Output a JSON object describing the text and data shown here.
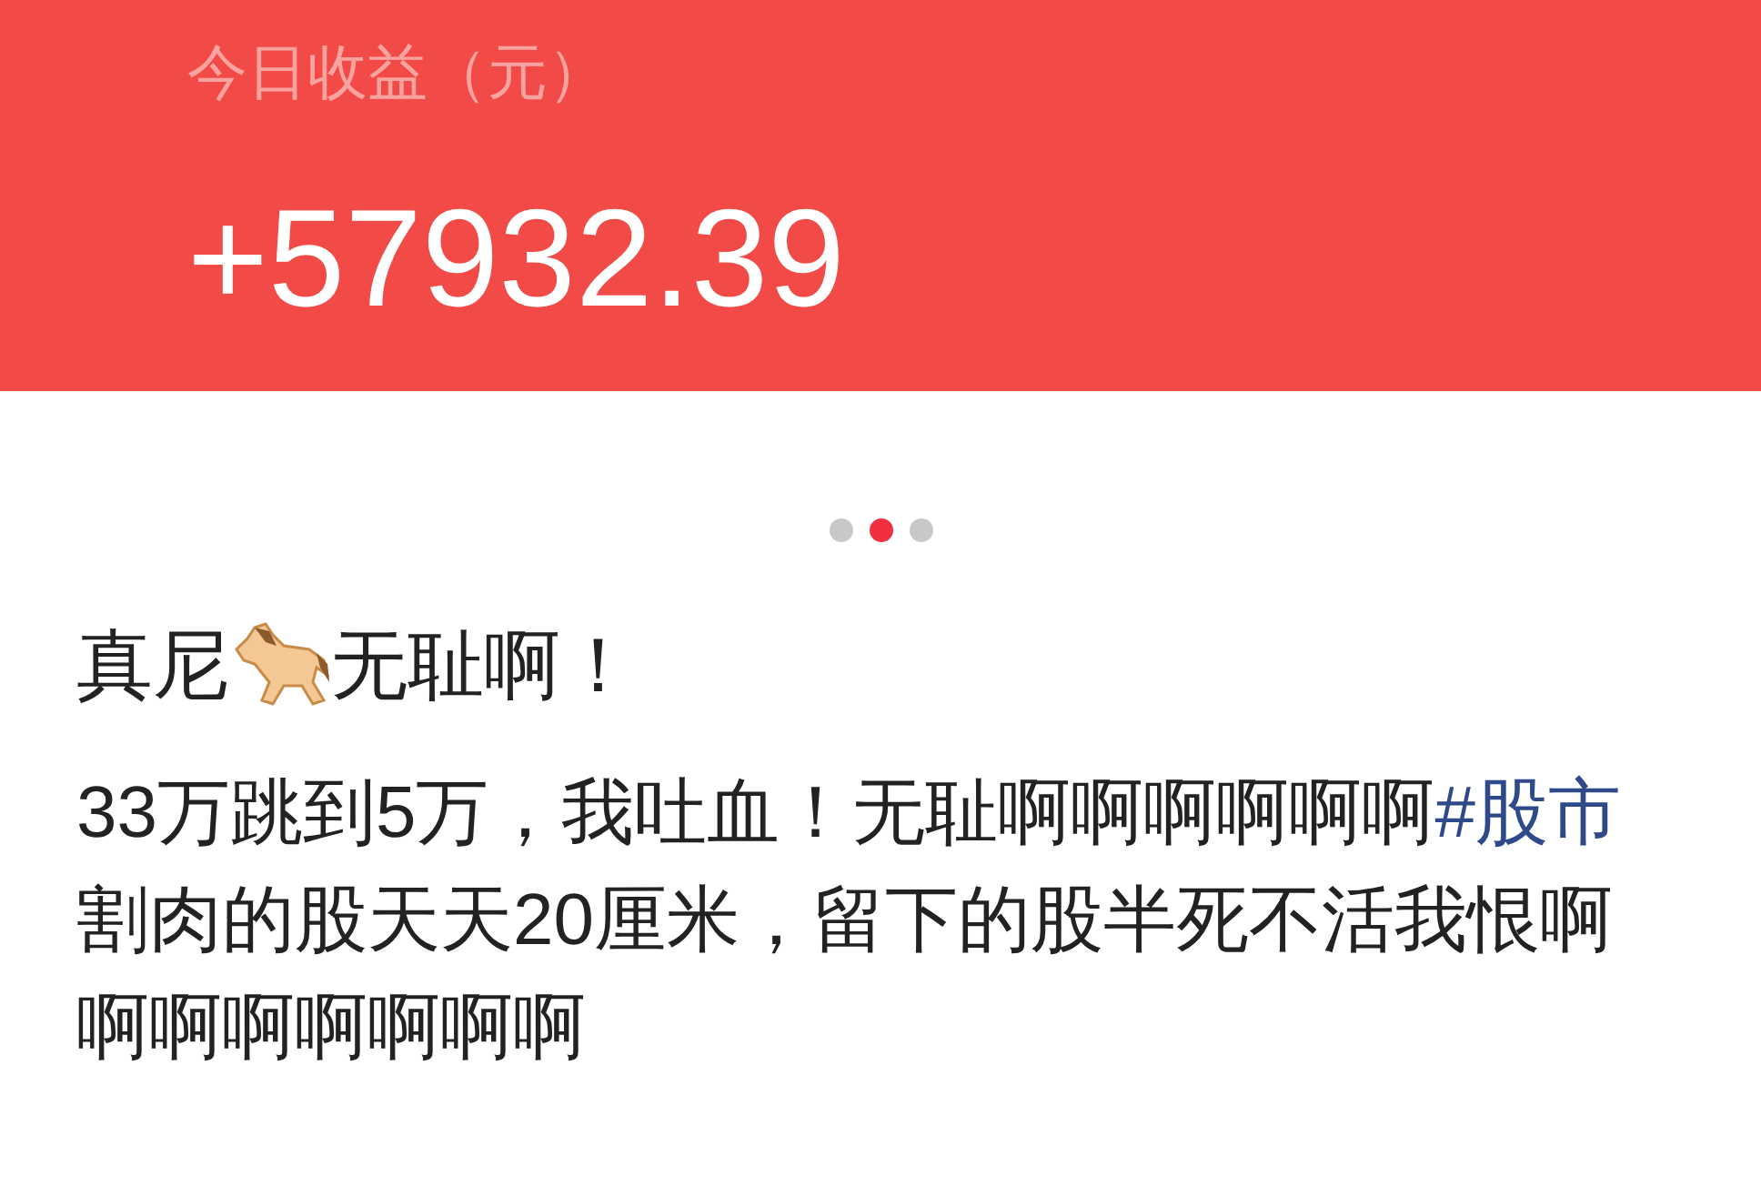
{
  "earnings": {
    "label": "今日收益（元）",
    "amount": "+57932.39"
  },
  "carousel": {
    "dots": [
      {
        "selected": false
      },
      {
        "selected": true
      },
      {
        "selected": false
      }
    ]
  },
  "post": {
    "title_start": "真尼",
    "title_end": "无耻啊！",
    "body": "33万跳到5万，我吐血！无耻啊啊啊啊啊啊",
    "hashtag": "#股市",
    "body_rest": "割肉的股天天20厘米，留下的股半死不活我恨啊啊啊啊啊啊啊啊"
  }
}
